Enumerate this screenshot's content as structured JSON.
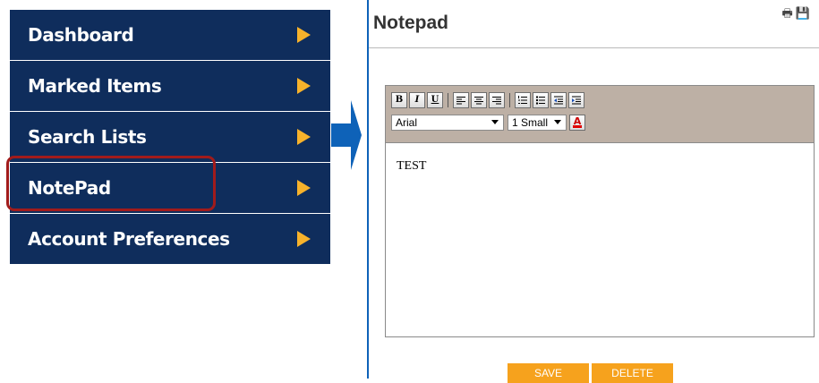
{
  "sidebar": {
    "items": [
      {
        "label": "Dashboard"
      },
      {
        "label": "Marked Items"
      },
      {
        "label": "Search Lists"
      },
      {
        "label": "NotePad"
      },
      {
        "label": "Account Preferences"
      }
    ],
    "highlighted": "NotePad"
  },
  "colors": {
    "nav_bg": "#0f2d5c",
    "nav_arrow": "#f7b22b",
    "highlight_border": "#a11b1b",
    "connector_arrow": "#0e62b8",
    "toolbar_bg": "#bdb0a5",
    "action_button": "#f6a21d"
  },
  "notepad": {
    "title": "Notepad",
    "header_icons": [
      "print-icon",
      "save-disk-icon"
    ],
    "toolbar": {
      "format_buttons": [
        "B",
        "I",
        "U"
      ],
      "align_icons": [
        "align-left-icon",
        "align-center-icon",
        "align-right-icon"
      ],
      "list_icons": [
        "ordered-list-icon",
        "unordered-list-icon",
        "outdent-icon",
        "indent-icon"
      ],
      "font_family": "Arial",
      "font_size": "1 Small",
      "text_color_icon": "text-color-icon"
    },
    "content": "TEST",
    "buttons": {
      "save": "SAVE",
      "delete": "DELETE"
    }
  }
}
